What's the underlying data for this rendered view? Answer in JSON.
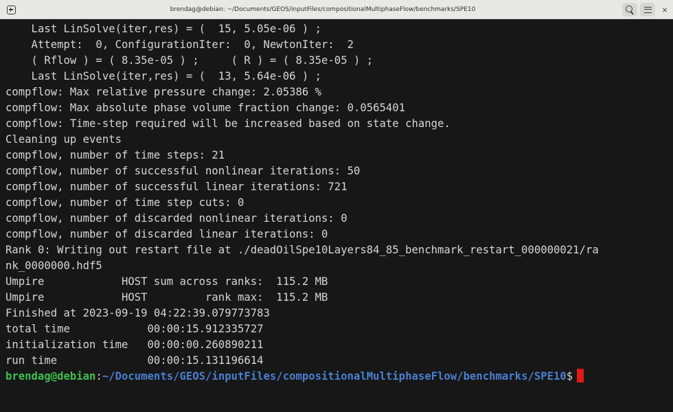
{
  "window": {
    "title": "brendag@debian: ~/Documents/GEOS/inputFiles/compositionalMultiphaseFlow/benchmarks/SPE10",
    "close_glyph": "×",
    "icons": [
      "new-tab-icon",
      "search-icon",
      "menu-icon",
      "close-icon"
    ]
  },
  "terminal": {
    "lines": [
      "    Last LinSolve(iter,res) = (  15, 5.05e-06 ) ;",
      "    Attempt:  0, ConfigurationIter:  0, NewtonIter:  2",
      "    ( Rflow ) = ( 8.35e-05 ) ;     ( R ) = ( 8.35e-05 ) ;",
      "    Last LinSolve(iter,res) = (  13, 5.64e-06 ) ;",
      "compflow: Max relative pressure change: 2.05386 %",
      "compflow: Max absolute phase volume fraction change: 0.0565401",
      "compflow: Time-step required will be increased based on state change.",
      "Cleaning up events",
      "compflow, number of time steps: 21",
      "compflow, number of successful nonlinear iterations: 50",
      "compflow, number of successful linear iterations: 721",
      "compflow, number of time step cuts: 0",
      "compflow, number of discarded nonlinear iterations: 0",
      "compflow, number of discarded linear iterations: 0",
      "Rank 0: Writing out restart file at ./deadOilSpe10Layers84_85_benchmark_restart_000000021/ra",
      "nk_0000000.hdf5",
      "Umpire            HOST sum across ranks:  115.2 MB",
      "Umpire            HOST         rank max:  115.2 MB",
      "Finished at 2023-09-19 04:22:39.079773783",
      "total time            00:00:15.912335727",
      "initialization time   00:00:00.260890211",
      "run time              00:00:15.131196614"
    ],
    "prompt": {
      "user_host": "brendag@debian",
      "separator": ":",
      "path": "~/Documents/GEOS/inputFiles/compositionalMultiphaseFlow/benchmarks/SPE10",
      "symbol": "$"
    },
    "colors": {
      "background": "#171717",
      "text": "#d6d6d6",
      "prompt_user": "#3fbf4f",
      "prompt_path": "#4a7fd0",
      "cursor": "#e21a1a"
    }
  }
}
